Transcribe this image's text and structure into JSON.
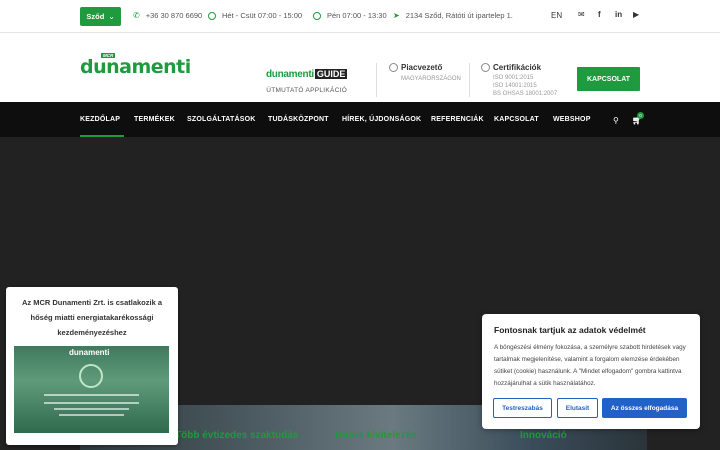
{
  "topbar": {
    "location_button": "Sződ",
    "phone": "+36 30 870 6690",
    "hours_weekdays": "Hét - Csüt 07:00 - 15:00",
    "hours_friday": "Pén 07:00 - 13:30",
    "address": "2134 Sződ, Rátóti út ipartelep 1.",
    "language": "EN",
    "social_icons": [
      "mail-icon",
      "facebook-icon",
      "linkedin-icon",
      "youtube-icon"
    ]
  },
  "header": {
    "logo_badge": "MCR",
    "logo_text": "dunamenti",
    "guide_part1": "dunamenti",
    "guide_part2": "GUIDE",
    "guide_sub": "ÚTMUTATÓ APPLIKÁCIÓ",
    "leader_title": "Piacvezető",
    "leader_sub": "MAGYARORSZÁGON",
    "cert_title": "Certifikációk",
    "cert_lines": [
      "ISO 9001:2015",
      "ISO 14001:2015",
      "BS OHSAS 18001:2007"
    ],
    "contact_button": "KAPCSOLAT"
  },
  "nav": {
    "items": [
      "KEZDŐLAP",
      "TERMÉKEK",
      "SZOLGÁLTATÁSOK",
      "TUDÁSKÖZPONT",
      "HÍREK, ÚJDONSÁGOK",
      "REFERENCIÁK",
      "KAPCSOLAT",
      "WEBSHOP"
    ],
    "cart_count": "0"
  },
  "hero": {
    "label_a": "Több évtizedes szaktudás",
    "label_b": "Gyors kivitelezés",
    "label_c": "Innováció"
  },
  "popup": {
    "title": "Az MCR Dunamenti Zrt. is csatlakozik a hőség miatti energiatakarékossági kezdeményezéshez",
    "image_logo": "dunamenti"
  },
  "cookie": {
    "title": "Fontosnak tartjuk az adatok védelmét",
    "text": "A böngészési élmény fokozása, a személyre szabott hirdetések vagy tartalmak megjelenítése, valamint a forgalom elemzése érdekében sütiket (cookie) használunk. A \"Mindet elfogadom\" gombra kattintva hozzájárulhat a sütik használatához.",
    "btn_customize": "Testreszabás",
    "btn_reject": "Elutasít",
    "btn_accept": "Az összes elfogadása"
  },
  "colors": {
    "brand_green": "#1f9a3e",
    "nav_bg": "#0e0e0e",
    "cookie_blue": "#2261c8"
  }
}
